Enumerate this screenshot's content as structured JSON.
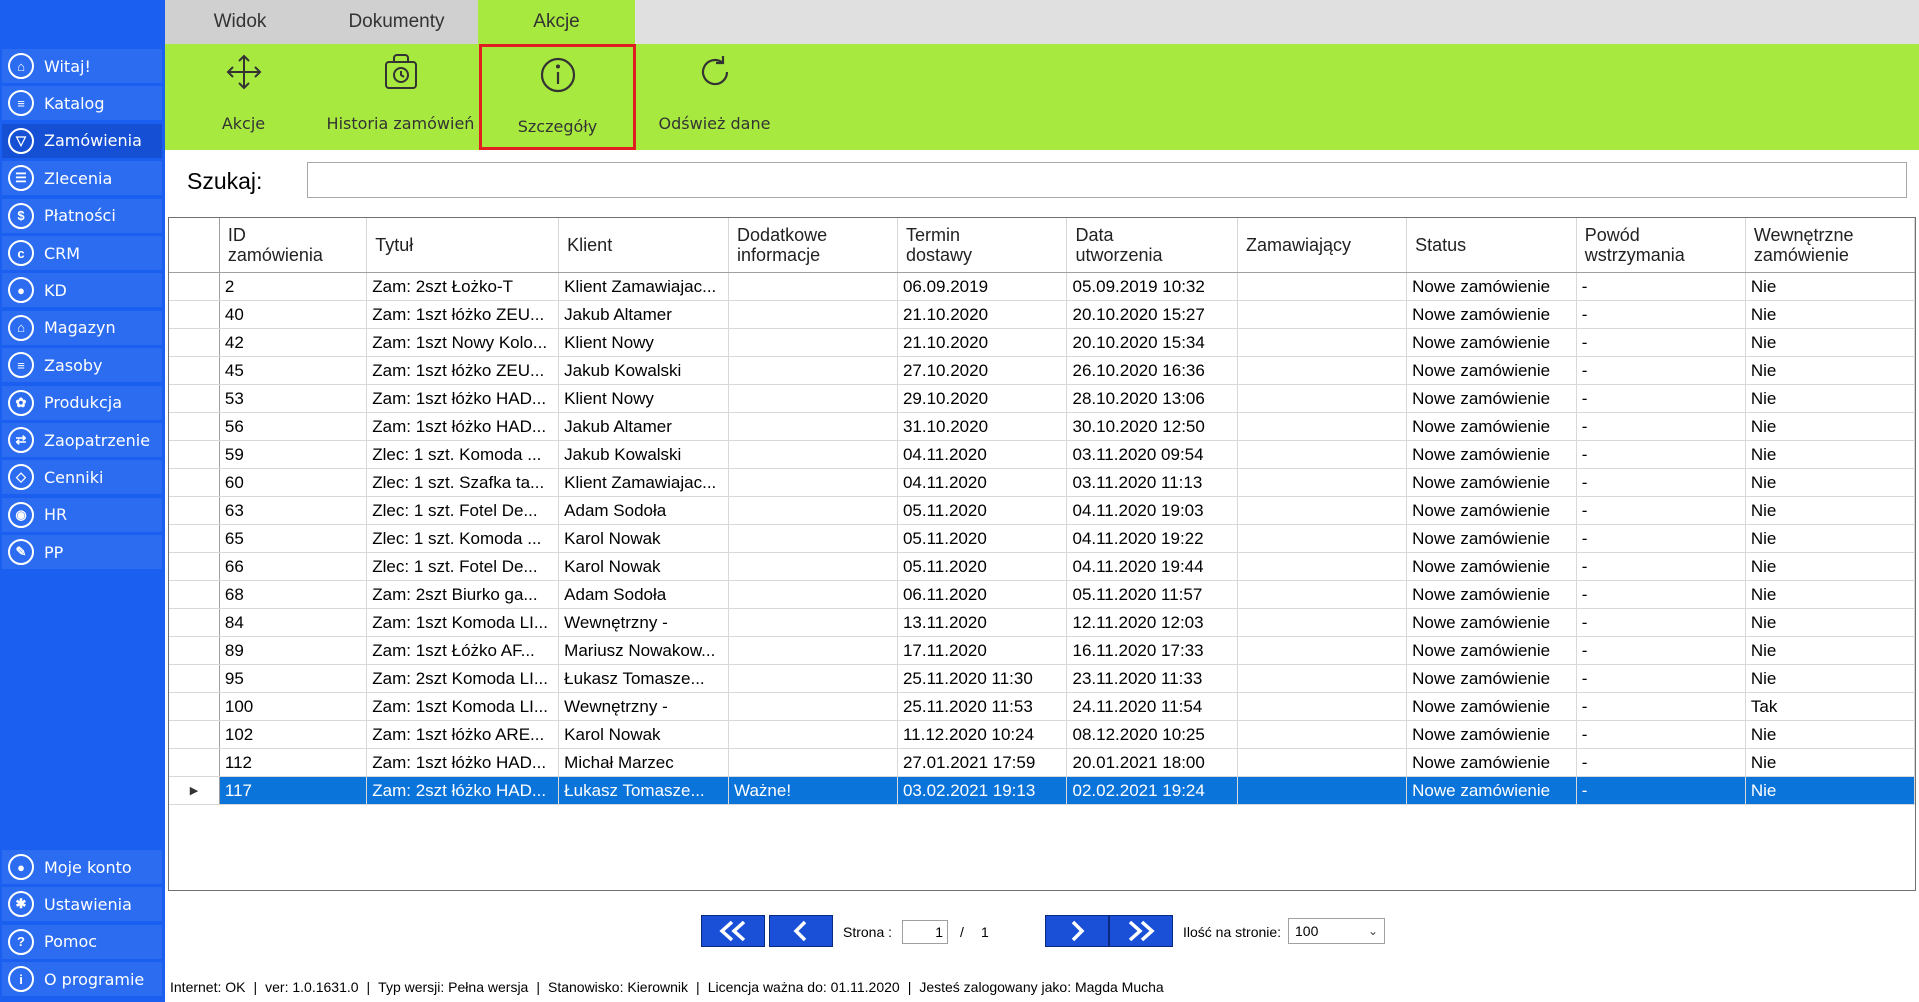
{
  "sidebar": {
    "items": [
      {
        "label": "Witaj!",
        "icon": "home-icon"
      },
      {
        "label": "Katalog",
        "icon": "book-icon"
      },
      {
        "label": "Zamówienia",
        "icon": "cart-icon"
      },
      {
        "label": "Zlecenia",
        "icon": "list-icon"
      },
      {
        "label": "Płatności",
        "icon": "dollar-icon"
      },
      {
        "label": "CRM",
        "icon": "crm-icon"
      },
      {
        "label": "KD",
        "icon": "person-icon"
      },
      {
        "label": "Magazyn",
        "icon": "warehouse-icon"
      },
      {
        "label": "Zasoby",
        "icon": "resources-icon"
      },
      {
        "label": "Produkcja",
        "icon": "production-icon"
      },
      {
        "label": "Zaopatrzenie",
        "icon": "supply-icon"
      },
      {
        "label": "Cenniki",
        "icon": "tag-icon"
      },
      {
        "label": "HR",
        "icon": "hr-icon"
      },
      {
        "label": "PP",
        "icon": "pp-icon"
      }
    ],
    "bottom_items": [
      {
        "label": "Moje konto",
        "icon": "user-icon"
      },
      {
        "label": "Ustawienia",
        "icon": "gear-icon"
      },
      {
        "label": "Pomoc",
        "icon": "question-icon"
      },
      {
        "label": "O programie",
        "icon": "info-icon"
      }
    ],
    "active_label": "Zamówienia"
  },
  "tabs": [
    {
      "label": "Widok"
    },
    {
      "label": "Dokumenty"
    },
    {
      "label": "Akcje"
    }
  ],
  "active_tab": "Akcje",
  "ribbon": {
    "buttons": [
      {
        "label": "Akcje",
        "icon": "move-arrows-icon"
      },
      {
        "label": "Historia zamówień",
        "icon": "history-bag-icon"
      },
      {
        "label": "Szczegóły",
        "icon": "info-circle-icon"
      },
      {
        "label": "Odśwież dane",
        "icon": "refresh-icon"
      }
    ],
    "selected": "Szczegóły"
  },
  "search": {
    "label": "Szukaj:",
    "value": ""
  },
  "table": {
    "columns": [
      "ID\nzamówienia",
      "Tytuł",
      "Klient",
      "Dodatkowe\ninformacje",
      "Termin\ndostawy",
      "Data\nutworzenia",
      "Zamawiający",
      "Status",
      "Powód\nwstrzymania",
      "Wewnętrzne\nzamówienie"
    ],
    "rows": [
      [
        "2",
        "Zam: 2szt Łożko-T",
        "Klient Zamawiajac...",
        "",
        "06.09.2019",
        "05.09.2019 10:32",
        "",
        "Nowe zamówienie",
        "-",
        "Nie"
      ],
      [
        "40",
        "Zam: 1szt łóżko ZEU...",
        "Jakub  Altamer",
        "",
        "21.10.2020",
        "20.10.2020 15:27",
        "",
        "Nowe zamówienie",
        "-",
        "Nie"
      ],
      [
        "42",
        "Zam: 1szt Nowy Kolo...",
        "Klient Nowy",
        "",
        "21.10.2020",
        "20.10.2020 15:34",
        "",
        "Nowe zamówienie",
        "-",
        "Nie"
      ],
      [
        "45",
        "Zam: 1szt łóżko ZEU...",
        "Jakub Kowalski",
        "",
        "27.10.2020",
        "26.10.2020 16:36",
        "",
        "Nowe zamówienie",
        "-",
        "Nie"
      ],
      [
        "53",
        "Zam: 1szt łóżko HAD...",
        "Klient Nowy",
        "",
        "29.10.2020",
        "28.10.2020 13:06",
        "",
        "Nowe zamówienie",
        "-",
        "Nie"
      ],
      [
        "56",
        "Zam: 1szt łóżko HAD...",
        "Jakub  Altamer",
        "",
        "31.10.2020",
        "30.10.2020 12:50",
        "",
        "Nowe zamówienie",
        "-",
        "Nie"
      ],
      [
        "59",
        "Zlec: 1 szt. Komoda ...",
        "Jakub Kowalski",
        "",
        "04.11.2020",
        "03.11.2020 09:54",
        "",
        "Nowe zamówienie",
        "-",
        "Nie"
      ],
      [
        "60",
        "Zlec: 1 szt. Szafka ta...",
        "Klient Zamawiajac...",
        "",
        "04.11.2020",
        "03.11.2020 11:13",
        "",
        "Nowe zamówienie",
        "-",
        "Nie"
      ],
      [
        "63",
        "Zlec: 1 szt. Fotel De...",
        "Adam Sodoła",
        "",
        "05.11.2020",
        "04.11.2020 19:03",
        "",
        "Nowe zamówienie",
        "-",
        "Nie"
      ],
      [
        "65",
        "Zlec: 1 szt. Komoda ...",
        "Karol Nowak",
        "",
        "05.11.2020",
        "04.11.2020 19:22",
        "",
        "Nowe zamówienie",
        "-",
        "Nie"
      ],
      [
        "66",
        "Zlec: 1 szt. Fotel De...",
        "Karol Nowak",
        "",
        "05.11.2020",
        "04.11.2020 19:44",
        "",
        "Nowe zamówienie",
        "-",
        "Nie"
      ],
      [
        "68",
        "Zam: 2szt Biurko ga...",
        "Adam Sodoła",
        "",
        "06.11.2020",
        "05.11.2020 11:57",
        "",
        "Nowe zamówienie",
        "-",
        "Nie"
      ],
      [
        "84",
        "Zam: 1szt Komoda LI...",
        "Wewnętrzny -",
        "",
        "13.11.2020",
        "12.11.2020 12:03",
        "",
        "Nowe zamówienie",
        "-",
        "Nie"
      ],
      [
        "89",
        "Zam: 1szt Łóżko AF...",
        "Mariusz Nowakow...",
        "",
        "17.11.2020",
        "16.11.2020 17:33",
        "",
        "Nowe zamówienie",
        "-",
        "Nie"
      ],
      [
        "95",
        "Zam: 2szt Komoda LI...",
        "Łukasz Tomasze...",
        "",
        "25.11.2020 11:30",
        "23.11.2020 11:33",
        "",
        "Nowe zamówienie",
        "-",
        "Nie"
      ],
      [
        "100",
        "Zam: 1szt Komoda LI...",
        "Wewnętrzny -",
        "",
        "25.11.2020 11:53",
        "24.11.2020 11:54",
        "",
        "Nowe zamówienie",
        "-",
        "Tak"
      ],
      [
        "102",
        "Zam: 1szt łóżko ARE...",
        "Karol Nowak",
        "",
        "11.12.2020 10:24",
        "08.12.2020 10:25",
        "",
        "Nowe zamówienie",
        "-",
        "Nie"
      ],
      [
        "112",
        "Zam: 1szt łóżko HAD...",
        "Michał Marzec",
        "",
        "27.01.2021 17:59",
        "20.01.2021 18:00",
        "",
        "Nowe zamówienie",
        "-",
        "Nie"
      ],
      [
        "117",
        "Zam: 2szt łóżko HAD...",
        "Łukasz Tomasze...",
        "Ważne!",
        "03.02.2021 19:13",
        "02.02.2021 19:24",
        "",
        "Nowe zamówienie",
        "-",
        "Nie"
      ]
    ],
    "selected_row": 18
  },
  "pagination": {
    "page_label": "Strona :",
    "page_value": "1",
    "separator": "/",
    "total_pages": "1",
    "per_page_label": "Ilość na stronie:",
    "per_page_value": "100"
  },
  "statusbar": {
    "items": [
      "Internet: OK",
      "ver: 1.0.1631.0",
      "Typ wersji: Pełna wersja",
      "Stanowisko: Kierownik",
      "Licencja ważna do: 01.11.2020",
      "Jesteś zalogowany jako: Magda Mucha"
    ]
  },
  "colors": {
    "sidebar": "#1a5ff0",
    "ribbon": "#a8e940",
    "selection": "#0b74da",
    "highlight_border": "#e02020"
  }
}
